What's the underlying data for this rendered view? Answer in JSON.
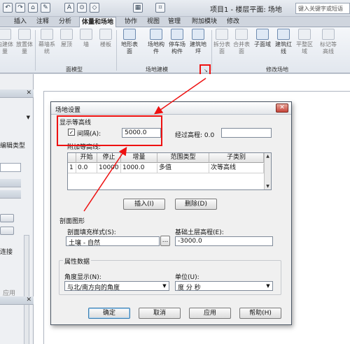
{
  "window": {
    "title": "项目1 - 楼层平面: 场地",
    "search_placeholder": "键入关键字或短语"
  },
  "quick_access": [
    "↶",
    "↷",
    "⌂",
    "✎",
    "A",
    "⊙",
    "◇",
    "▦",
    "⌗"
  ],
  "ribbon": {
    "tabs": [
      "插入",
      "注释",
      "分析",
      "体量和场地",
      "协作",
      "视图",
      "管理",
      "附加模块",
      "修改"
    ],
    "active_tab": "体量和场地",
    "buttons": [
      {
        "label": "内建体量"
      },
      {
        "label": "放置体量"
      },
      {
        "label": "幕墙系统"
      },
      {
        "label": "屋顶"
      },
      {
        "label": "墙"
      },
      {
        "label": "楼板"
      },
      {
        "label": "地形表面"
      },
      {
        "label": "场地构件"
      },
      {
        "label": "停车场构件"
      },
      {
        "label": "建筑地坪"
      },
      {
        "label": "拆分表面"
      },
      {
        "label": "合并表面"
      },
      {
        "label": "子面域"
      },
      {
        "label": "建筑红线"
      },
      {
        "label": "平整区域"
      },
      {
        "label": "标记等高线"
      }
    ],
    "groups": [
      "面模型",
      "场地建模",
      "修改场地"
    ]
  },
  "left_panel": {
    "edit_type": "编辑类型",
    "connect": "连接",
    "apply": "应用"
  },
  "dialog": {
    "title": "场地设置",
    "contour_section": "显示等高线",
    "interval_checkbox": "间隔(A):",
    "interval_checked": "✓",
    "interval_value": "5000.0",
    "elevation_label": "经过高程: 0.0",
    "additional_contours": "附加等高线:",
    "table": {
      "headers": [
        "开始",
        "停止",
        "增量",
        "范围类型",
        "子类别"
      ],
      "row": {
        "num": "1",
        "start": "0.0",
        "stop": "10000",
        "increment": "1000.0",
        "range_type": "多值",
        "subcategory": "次等高线"
      }
    },
    "insert_button": "插入(I)",
    "delete_button": "删除(D)",
    "section_graphics": "剖面图形",
    "fill_style_label": "剖面填充样式(S):",
    "fill_style_value": "土壤 - 自然",
    "fill_browse": "...",
    "base_elevation_label": "基础土层高程(E):",
    "base_elevation_value": "-3000.0",
    "property_data": "属性数据",
    "angle_label": "角度显示(N):",
    "angle_value": "与北/南方向的角度",
    "units_label": "单位(U):",
    "units_value": "度 分 秒",
    "ok": "确定",
    "cancel": "取消",
    "apply": "应用",
    "help": "帮助(H)"
  }
}
